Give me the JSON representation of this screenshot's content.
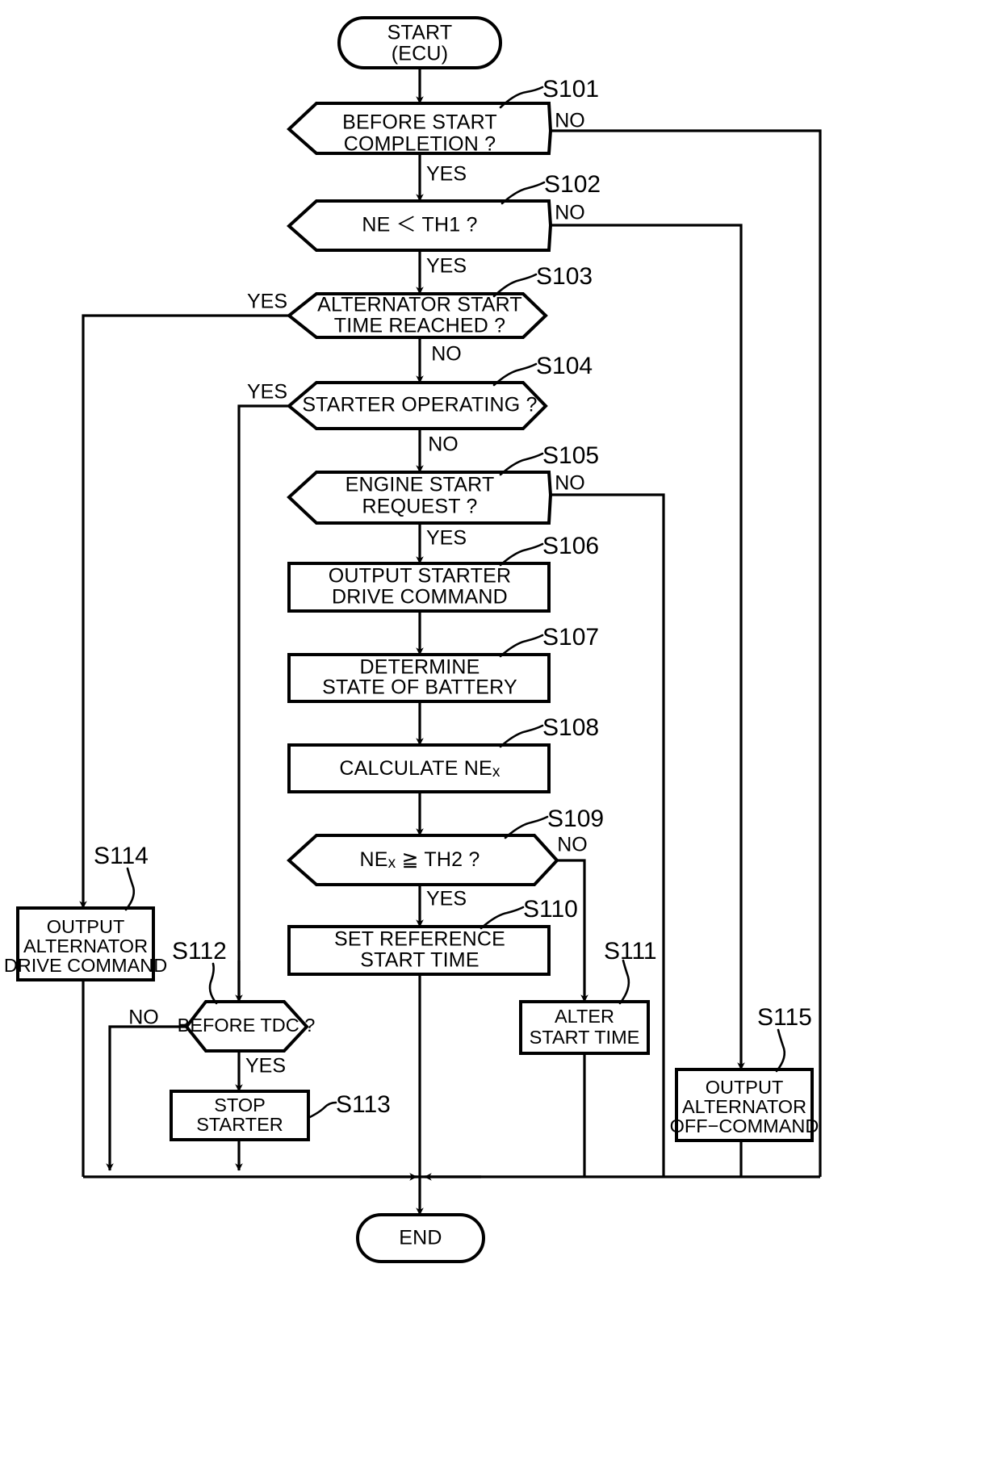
{
  "diagram": {
    "type": "flowchart",
    "title": "",
    "terminals": {
      "start": {
        "line1": "START",
        "line2": "(ECU)"
      },
      "end": {
        "line1": "END"
      }
    },
    "branch_labels": {
      "yes": "YES",
      "no": "NO"
    },
    "nodes": [
      {
        "id": "start",
        "kind": "terminal",
        "step": "",
        "lines": [
          "START",
          "(ECU)"
        ]
      },
      {
        "id": "s101",
        "kind": "decision",
        "step": "S101",
        "lines": [
          "BEFORE START",
          "COMPLETION ?"
        ],
        "yes": "down",
        "no": "right"
      },
      {
        "id": "s102",
        "kind": "decision",
        "step": "S102",
        "lines": [
          "NE ＜ TH1 ?"
        ],
        "yes": "down",
        "no": "right"
      },
      {
        "id": "s103",
        "kind": "decision",
        "step": "S103",
        "lines": [
          "ALTERNATOR START",
          "TIME REACHED ?"
        ],
        "yes": "left",
        "no": "down"
      },
      {
        "id": "s104",
        "kind": "decision",
        "step": "S104",
        "lines": [
          "STARTER OPERATING ?"
        ],
        "yes": "left",
        "no": "down"
      },
      {
        "id": "s105",
        "kind": "decision",
        "step": "S105",
        "lines": [
          "ENGINE START",
          "REQUEST ?"
        ],
        "yes": "down",
        "no": "right"
      },
      {
        "id": "s106",
        "kind": "process",
        "step": "S106",
        "lines": [
          "OUTPUT STARTER",
          "DRIVE COMMAND"
        ]
      },
      {
        "id": "s107",
        "kind": "process",
        "step": "S107",
        "lines": [
          "DETERMINE",
          "STATE OF BATTERY"
        ]
      },
      {
        "id": "s108",
        "kind": "process",
        "step": "S108",
        "lines": [
          "CALCULATE NEx"
        ],
        "subscript": "x",
        "base": "CALCULATE NE"
      },
      {
        "id": "s109",
        "kind": "decision",
        "step": "S109",
        "lines": [
          "NEx ≧ TH2 ?"
        ],
        "base": "NE",
        "subscript": "x",
        "tail": " ≧ TH2 ?",
        "yes": "down",
        "no": "right"
      },
      {
        "id": "s110",
        "kind": "process",
        "step": "S110",
        "lines": [
          "SET REFERENCE",
          "START TIME"
        ]
      },
      {
        "id": "s111",
        "kind": "process",
        "step": "S111",
        "lines": [
          "ALTER",
          "START TIME"
        ]
      },
      {
        "id": "s112",
        "kind": "decision",
        "step": "S112",
        "lines": [
          "BEFORE TDC ?"
        ],
        "yes": "down",
        "no": "left"
      },
      {
        "id": "s113",
        "kind": "process",
        "step": "S113",
        "lines": [
          "STOP",
          "STARTER"
        ]
      },
      {
        "id": "s114",
        "kind": "process",
        "step": "S114",
        "lines": [
          "OUTPUT",
          "ALTERNATOR",
          "DRIVE COMMAND"
        ]
      },
      {
        "id": "s115",
        "kind": "process",
        "step": "S115",
        "lines": [
          "OUTPUT",
          "ALTERNATOR",
          "OFF−COMMAND"
        ]
      },
      {
        "id": "end",
        "kind": "terminal",
        "step": "",
        "lines": [
          "END"
        ]
      }
    ],
    "edge_labels": [
      {
        "id": "s101-yes",
        "text": "YES"
      },
      {
        "id": "s101-no",
        "text": "NO"
      },
      {
        "id": "s102-yes",
        "text": "YES"
      },
      {
        "id": "s102-no",
        "text": "NO"
      },
      {
        "id": "s103-yes",
        "text": "YES"
      },
      {
        "id": "s103-no",
        "text": "NO"
      },
      {
        "id": "s104-yes",
        "text": "YES"
      },
      {
        "id": "s104-no",
        "text": "NO"
      },
      {
        "id": "s105-yes",
        "text": "YES"
      },
      {
        "id": "s105-no",
        "text": "NO"
      },
      {
        "id": "s109-yes",
        "text": "YES"
      },
      {
        "id": "s109-no",
        "text": "NO"
      },
      {
        "id": "s112-yes",
        "text": "YES"
      },
      {
        "id": "s112-no",
        "text": "NO"
      }
    ],
    "colors": {
      "stroke": "#000000",
      "fill": "#ffffff",
      "text": "#000000"
    }
  }
}
